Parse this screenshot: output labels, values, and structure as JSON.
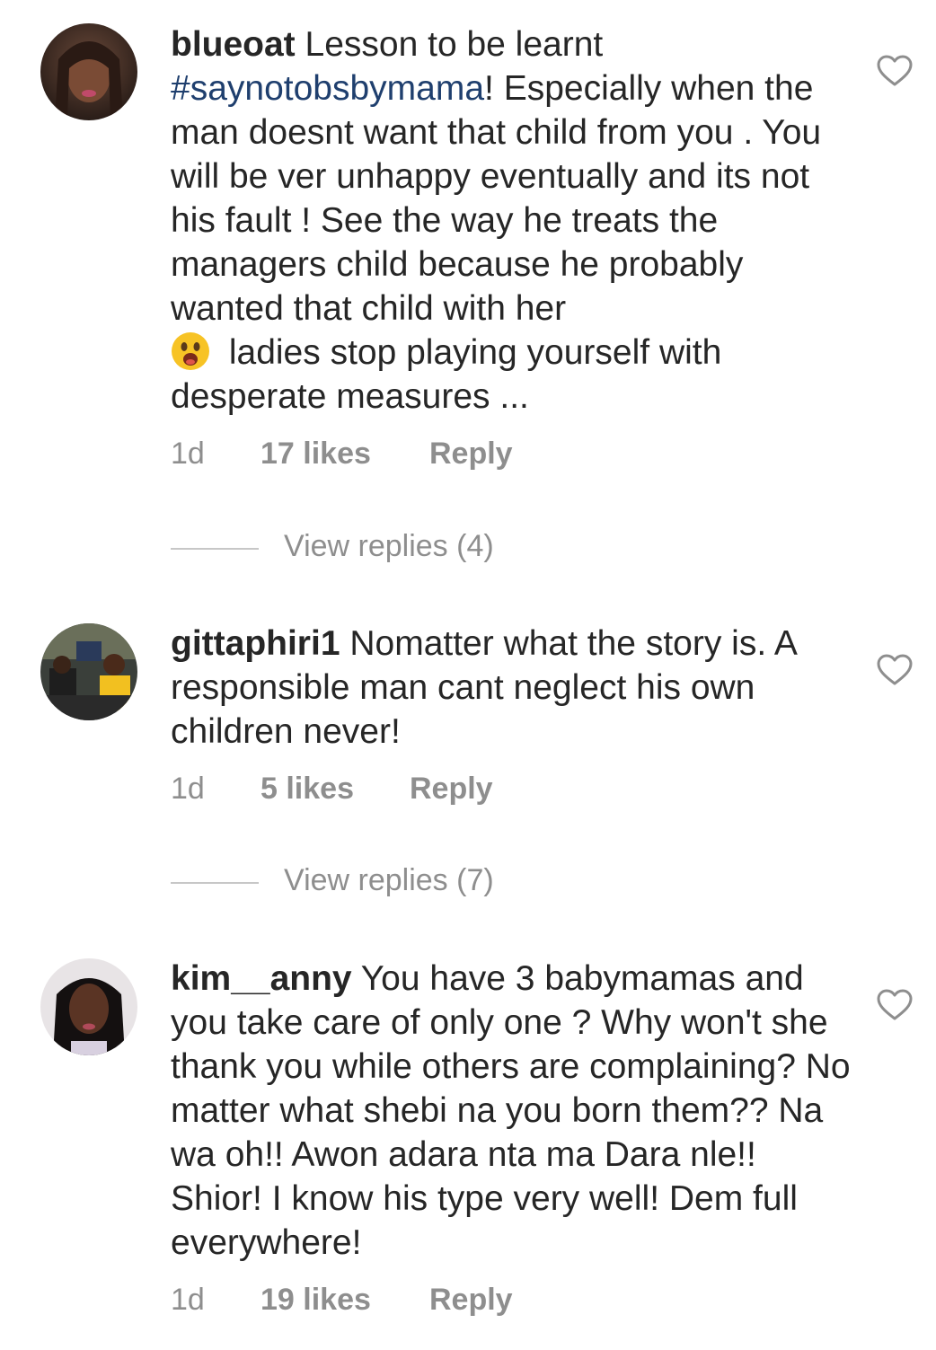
{
  "comments": [
    {
      "username": "blueoat",
      "text_before_hashtag": " Lesson to be learnt ",
      "hashtag": "#saynotobsbymama",
      "text_after_hashtag": "! Especially when the man doesnt want that child from you . You will be ver unhappy eventually and its not his fault ! See the way he treats the managers child because he probably wanted that child with her",
      "emoji": "face-with-open-mouth-emoji",
      "text_after_emoji": " ladies stop playing yourself with desperate measures ...",
      "time": "1d",
      "likes": "17 likes",
      "reply": "Reply",
      "view_replies": "View replies (4)"
    },
    {
      "username": "gittaphiri1",
      "text": " Nomatter what the story is. A responsible man cant neglect his own children never!",
      "time": "1d",
      "likes": "5 likes",
      "reply": "Reply",
      "view_replies": "View replies (7)"
    },
    {
      "username": "kim__anny",
      "text": " You have 3 babymamas and you take care of only one ? Why won't she thank you while others are complaining? No matter what shebi na you born them?? Na wa oh!! Awon adara nta ma Dara nle!! Shior! I know his type very well! Dem full everywhere!",
      "time": "1d",
      "likes": "19 likes",
      "reply": "Reply"
    }
  ],
  "colors": {
    "text": "#262626",
    "muted": "#8e8e8e",
    "hashtag": "#1f3f6e",
    "divider": "#c7c7c7"
  },
  "icons": {
    "like": "heart-icon"
  }
}
